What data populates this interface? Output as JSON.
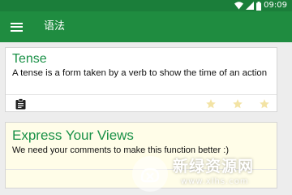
{
  "status_bar": {
    "time": "09:09",
    "icons": [
      "wifi-icon",
      "signal-icon",
      "battery-icon"
    ]
  },
  "toolbar": {
    "menu_icon": "menu-icon",
    "title": "语法"
  },
  "cards": [
    {
      "title": "Tense",
      "body": "A tense is a form taken by a verb to show the time of an action",
      "actions": {
        "clipboard_icon": "clipboard-icon",
        "stars": [
          "star-icon",
          "star-icon",
          "star-icon"
        ]
      }
    },
    {
      "title": "Express Your Views",
      "body": "We need your comments to make this function better :)"
    }
  ],
  "watermark": {
    "title": "新绿资源网",
    "url": "www.xlhs.com"
  },
  "colors": {
    "status_bar": "#1b7e3a",
    "toolbar": "#1f8c40",
    "title_green": "#1a9147",
    "background": "#ededed",
    "star": "#f3e3a4",
    "card_highlight": "#fffde8"
  }
}
